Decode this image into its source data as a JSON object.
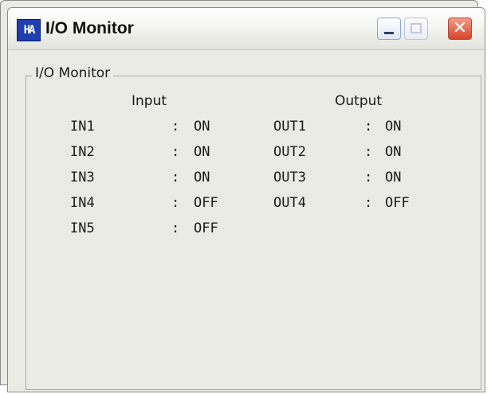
{
  "window": {
    "app_icon_text": "HA",
    "title": "I/O Monitor",
    "close_glyph": "✕"
  },
  "group": {
    "legend": "I/O Monitor",
    "input_header": "Input",
    "output_header": "Output",
    "separator": ":",
    "inputs": [
      {
        "label": "IN1",
        "value": "ON"
      },
      {
        "label": "IN2",
        "value": "ON"
      },
      {
        "label": "IN3",
        "value": "ON"
      },
      {
        "label": "IN4",
        "value": "OFF"
      },
      {
        "label": "IN5",
        "value": "OFF"
      }
    ],
    "outputs": [
      {
        "label": "OUT1",
        "value": "ON"
      },
      {
        "label": "OUT2",
        "value": "ON"
      },
      {
        "label": "OUT3",
        "value": "ON"
      },
      {
        "label": "OUT4",
        "value": "OFF"
      }
    ]
  }
}
